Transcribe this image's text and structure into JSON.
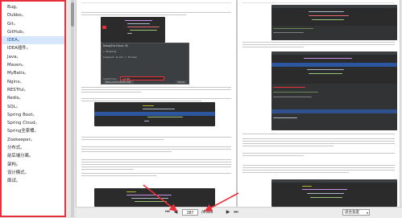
{
  "sidebar": {
    "items": [
      {
        "label": "Bug。"
      },
      {
        "label": "Dubbo。"
      },
      {
        "label": "Git。"
      },
      {
        "label": "GitHub。"
      },
      {
        "label": "IDEA。"
      },
      {
        "label": "IDEA插件。"
      },
      {
        "label": "Java。"
      },
      {
        "label": "Maven。"
      },
      {
        "label": "MyBatis。"
      },
      {
        "label": "Nginx。"
      },
      {
        "label": "RESTful。"
      },
      {
        "label": "Redis。"
      },
      {
        "label": "SQL。"
      },
      {
        "label": "Spring Boot。"
      },
      {
        "label": "Spring Cloud。"
      },
      {
        "label": "Spring全家桶。"
      },
      {
        "label": "Zookeeper。"
      },
      {
        "label": "分布式。"
      },
      {
        "label": "前后端分离。"
      },
      {
        "label": "架构。"
      },
      {
        "label": "设计模式。"
      },
      {
        "label": "面试。"
      }
    ],
    "active_index": 4
  },
  "dialog": {
    "title": "DebugTestJava:16",
    "enabled_label": "Enabled",
    "suspend_label": "Suspend:",
    "all_label": "All",
    "thread_label": "Thread",
    "condition_label": "Condition:",
    "condition_value": "i==10",
    "more_label": "More (Ctrl+Shift+F8)",
    "done_label": "Done"
  },
  "toolbar": {
    "first_icon": "first-page-icon",
    "prev_icon": "prev-page-icon",
    "next_icon": "next-page-icon",
    "last_icon": "last-page-icon",
    "current_page": "287",
    "total_pages": "/4588",
    "zoom_label": "适合宽度"
  },
  "colors": {
    "accent": "#e8303a",
    "active_bg": "#d6e6fb"
  }
}
